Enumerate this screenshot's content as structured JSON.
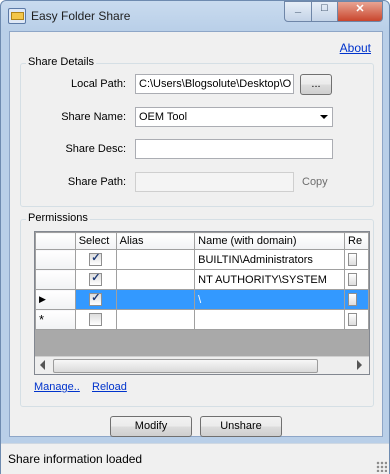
{
  "window": {
    "title": "Easy Folder Share"
  },
  "links": {
    "about": "About",
    "manage": "Manage..",
    "reload": "Reload"
  },
  "share_details": {
    "group_label": "Share Details",
    "local_path_label": "Local Path:",
    "local_path_value": "C:\\Users\\Blogsolute\\Desktop\\O",
    "browse_label": "...",
    "share_name_label": "Share Name:",
    "share_name_value": "OEM Tool",
    "share_desc_label": "Share Desc:",
    "share_desc_value": "",
    "share_path_label": "Share Path:",
    "share_path_value": "",
    "copy_label": "Copy"
  },
  "permissions": {
    "group_label": "Permissions",
    "columns": [
      "Select",
      "Alias",
      "Name (with domain)",
      "Re"
    ],
    "rows": [
      {
        "selected": true,
        "alias": "",
        "name": "BUILTIN\\Administrators",
        "indicator": ""
      },
      {
        "selected": true,
        "alias": "",
        "name": "NT AUTHORITY\\SYSTEM",
        "indicator": ""
      },
      {
        "selected": true,
        "alias": "",
        "name": "\\",
        "indicator": "▶"
      },
      {
        "selected": false,
        "alias": "",
        "name": "",
        "indicator": "*"
      }
    ]
  },
  "buttons": {
    "modify": "Modify",
    "unshare": "Unshare"
  },
  "status": {
    "text": "Share information loaded"
  }
}
